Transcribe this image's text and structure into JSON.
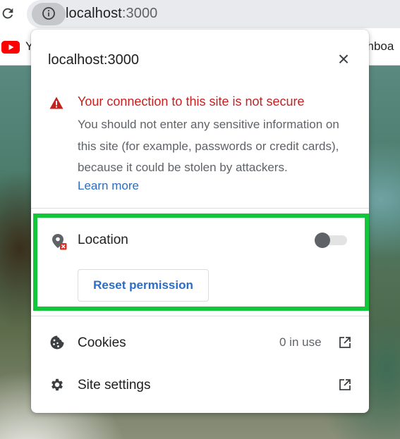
{
  "browser": {
    "url_host": "localhost",
    "url_port": ":3000",
    "bookmarks": [
      {
        "label": "Y",
        "icon": "youtube-icon"
      },
      {
        "label": "shboa",
        "icon": ""
      }
    ]
  },
  "popup": {
    "title": "localhost:3000",
    "close_label": "×",
    "warning": {
      "title": "Your connection to this site is not secure",
      "text": "You should not enter any sensitive information on this site (for example, passwords or credit cards), because it could be stolen by attackers.",
      "link": "Learn more"
    },
    "permission": {
      "label": "Location",
      "enabled": false,
      "reset_label": "Reset permission"
    },
    "rows": [
      {
        "label": "Cookies",
        "value": "0 in use",
        "icon": "cookie-icon"
      },
      {
        "label": "Site settings",
        "icon": "gear-icon"
      }
    ]
  },
  "colors": {
    "warning": "#c5221f",
    "link": "#2b6dc4",
    "highlight": "#12c83a"
  }
}
